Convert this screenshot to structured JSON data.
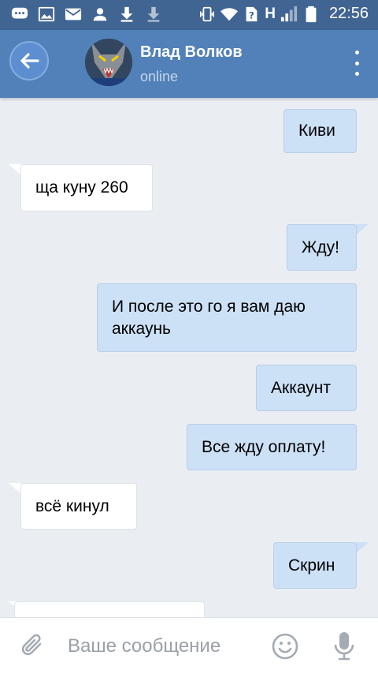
{
  "status_bar": {
    "time": "22:56",
    "icons": [
      "chat-notification-icon",
      "image-icon",
      "mail-icon",
      "person-icon",
      "download-icon",
      "download-icon",
      "vibrate-icon",
      "wifi-icon",
      "no-sim-icon",
      "signal-icon",
      "battery-icon"
    ],
    "network_label": "H"
  },
  "header": {
    "contact_name": "Влад Волков",
    "contact_status": "online",
    "back_icon": "arrow-left-icon",
    "menu_icon": "more-vertical-icon"
  },
  "messages": [
    {
      "text": "Киви",
      "direction": "out"
    },
    {
      "text": "ща куну 260",
      "direction": "in"
    },
    {
      "text": "Жду!",
      "direction": "out"
    },
    {
      "text": "И после это го я вам даю аккаунь",
      "direction": "out"
    },
    {
      "text": "Аккаунт",
      "direction": "out"
    },
    {
      "text": "Все жду оплату!",
      "direction": "out"
    },
    {
      "text": "всё кинул",
      "direction": "in"
    },
    {
      "text": "Скрин",
      "direction": "out"
    },
    {
      "text": "",
      "direction": "in"
    }
  ],
  "composer": {
    "placeholder": "Ваше сообщение",
    "attach_icon": "paperclip-icon",
    "emoji_icon": "smiley-icon",
    "mic_icon": "microphone-icon"
  },
  "colors": {
    "status_bar": "#416592",
    "header": "#5181b8",
    "chat_background": "#eaeef3",
    "outgoing_bubble": "#cce0f6",
    "incoming_bubble": "#ffffff"
  }
}
